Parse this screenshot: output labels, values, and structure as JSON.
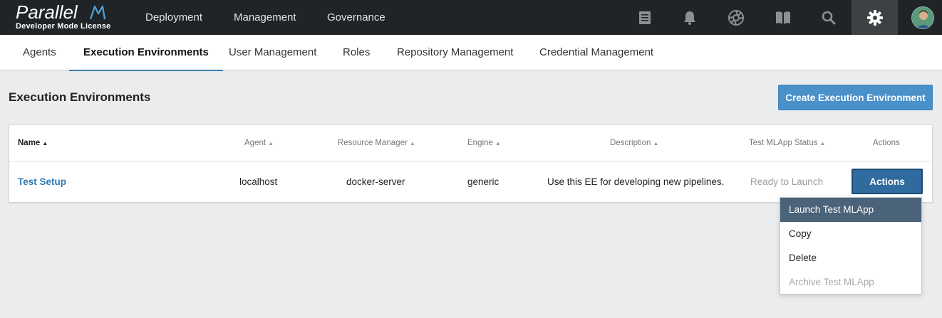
{
  "header": {
    "logo_text": "Parallel",
    "logo_subtitle": "Developer Mode License",
    "nav": [
      {
        "label": "Deployment"
      },
      {
        "label": "Management"
      },
      {
        "label": "Governance"
      }
    ],
    "icons": [
      "document-icon",
      "bell-icon",
      "aperture-icon",
      "book-icon",
      "search-icon",
      "gear-icon",
      "user-avatar"
    ]
  },
  "tabs": [
    {
      "label": "Agents"
    },
    {
      "label": "Execution Environments",
      "active": true
    },
    {
      "label": "User Management"
    },
    {
      "label": "Roles"
    },
    {
      "label": "Repository Management"
    },
    {
      "label": "Credential Management"
    }
  ],
  "page": {
    "title": "Execution Environments",
    "create_button": "Create Execution Environment"
  },
  "table": {
    "columns": [
      {
        "label": "Name",
        "sorted": true
      },
      {
        "label": "Agent"
      },
      {
        "label": "Resource Manager"
      },
      {
        "label": "Engine"
      },
      {
        "label": "Description"
      },
      {
        "label": "Test MLApp Status"
      },
      {
        "label": "Actions"
      }
    ],
    "rows": [
      {
        "name": "Test Setup",
        "agent": "localhost",
        "resource_manager": "docker-server",
        "engine": "generic",
        "description": "Use this EE for developing new pipelines.",
        "status": "Ready to Launch",
        "action_label": "Actions"
      }
    ]
  },
  "dropdown": {
    "items": [
      {
        "label": "Launch Test MLApp",
        "state": "highlighted"
      },
      {
        "label": "Copy",
        "state": "normal"
      },
      {
        "label": "Delete",
        "state": "normal"
      },
      {
        "label": "Archive Test MLApp",
        "state": "disabled"
      }
    ]
  },
  "colors": {
    "topbar": "#212426",
    "accent": "#3a7da8",
    "primary_button": "#4a90c9",
    "actions_button": "#2f6b9e",
    "menu_highlight": "#4a6378",
    "link": "#2d7bb8"
  }
}
